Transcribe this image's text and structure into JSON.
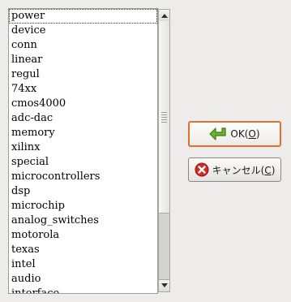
{
  "list": {
    "items": [
      "power",
      "device",
      "conn",
      "linear",
      "regul",
      "74xx",
      "cmos4000",
      "adc-dac",
      "memory",
      "xilinx",
      "special",
      "microcontrollers",
      "dsp",
      "microchip",
      "analog_switches",
      "motorola",
      "texas",
      "intel",
      "audio",
      "interface"
    ],
    "selected_index": 0
  },
  "buttons": {
    "ok_label": "OK(",
    "ok_mnemonic": "O",
    "ok_close": ")",
    "cancel_label": "キャンセル(",
    "cancel_mnemonic": "C",
    "cancel_close": ")"
  },
  "colors": {
    "ok_border": "#e0702a",
    "ok_icon": "#5aa324",
    "cancel_icon": "#d42a20"
  },
  "icons": {
    "ok": "green-left-arrow-icon",
    "cancel": "red-x-circle-icon"
  },
  "scrollbar": {
    "position_fraction": 0.0,
    "visible_fraction": 0.72
  }
}
